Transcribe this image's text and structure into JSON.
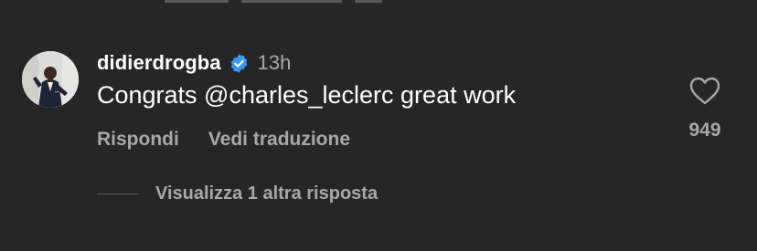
{
  "comment": {
    "username": "didierdrogba",
    "time": "13h",
    "text": "Congrats @charles_leclerc great work",
    "like_count": "949",
    "reply_label": "Rispondi",
    "translate_label": "Vedi traduzione",
    "view_replies_label": "Visualizza 1 altra risposta"
  },
  "icons": {
    "verified": "verified-badge-icon",
    "like": "heart-outline-icon"
  },
  "colors": {
    "background": "#262626",
    "primary_text": "#ffffff",
    "secondary_text": "#a8a8a8",
    "verified_badge": "#3897f0"
  }
}
